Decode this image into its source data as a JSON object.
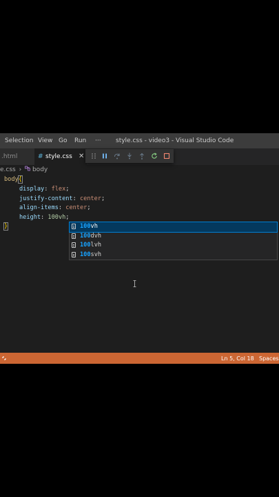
{
  "menubar": {
    "items": [
      "Selection",
      "View",
      "Go",
      "Run",
      "···"
    ],
    "window_title": "style.css - video3 - Visual Studio Code"
  },
  "tabs": [
    {
      "label": ".html",
      "active": false
    },
    {
      "label": "style.css",
      "active": true,
      "close": "✕"
    }
  ],
  "debug_toolbar": {
    "icons": [
      "drag-handle-icon",
      "pause-icon",
      "step-over-icon",
      "step-into-icon",
      "step-out-icon",
      "restart-icon",
      "stop-icon"
    ],
    "colors": {
      "pause": "#75beff",
      "restart": "#89d185",
      "stop": "#f48771"
    }
  },
  "breadcrumb": {
    "file": "e.css",
    "separator": "›",
    "symbol": "body"
  },
  "editor": {
    "selector": "body",
    "open_brace": "{",
    "close_brace": "}",
    "declarations": [
      {
        "prop": "display",
        "value": "flex"
      },
      {
        "prop": "justify-content",
        "value": "center"
      },
      {
        "prop": "align-items",
        "value": "center"
      },
      {
        "prop": "height",
        "number": "100",
        "unit": "vh"
      }
    ]
  },
  "suggestions": {
    "typed": "100vh",
    "items": [
      {
        "match": "100",
        "rest": "vh",
        "selected": true
      },
      {
        "match": "100",
        "rest": "dvh",
        "selected": false
      },
      {
        "match": "100",
        "rest": "lvh",
        "selected": false
      },
      {
        "match": "100",
        "rest": "svh",
        "selected": false
      }
    ]
  },
  "statusbar": {
    "position": "Ln 5, Col 18",
    "indent": "Spaces:",
    "color": "#cc6633"
  }
}
